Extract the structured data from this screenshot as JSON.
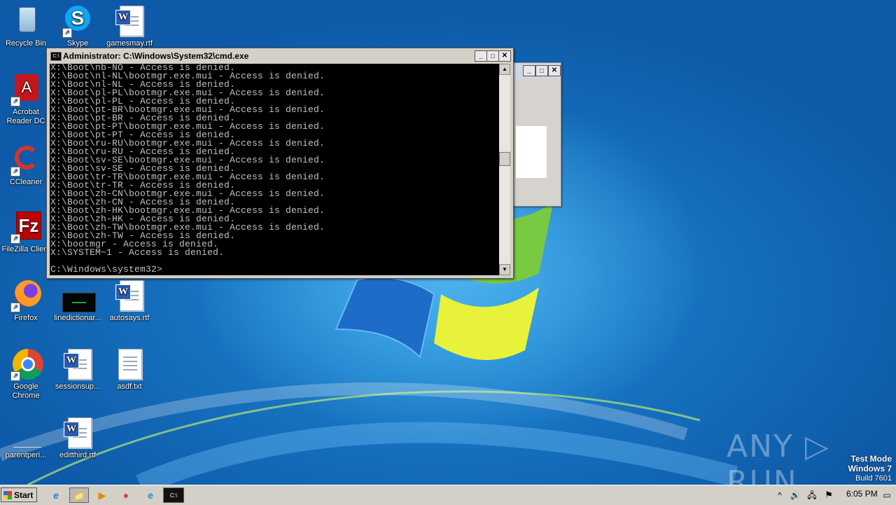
{
  "desktop": {
    "icons": [
      {
        "label": "Recycle Bin",
        "icon": "recycle-bin-icon"
      },
      {
        "label": "Skype",
        "icon": "skype-icon"
      },
      {
        "label": "gamesmay.rtf",
        "icon": "word-document-icon"
      },
      {
        "label": "Acrobat Reader DC",
        "icon": "acrobat-icon"
      },
      {
        "label": "CCleaner",
        "icon": "ccleaner-icon"
      },
      {
        "label": "FileZilla Client",
        "icon": "filezilla-icon"
      },
      {
        "label": "Firefox",
        "icon": "firefox-icon"
      },
      {
        "label": "linedictionar...",
        "icon": "black-file-icon"
      },
      {
        "label": "autosays.rtf",
        "icon": "word-document-icon"
      },
      {
        "label": "Google Chrome",
        "icon": "chrome-icon"
      },
      {
        "label": "sessionsup...",
        "icon": "word-document-icon"
      },
      {
        "label": "asdf.txt",
        "icon": "text-file-icon"
      },
      {
        "label": "parentperi...",
        "icon": "blank-file-icon"
      },
      {
        "label": "editthird.rtf",
        "icon": "word-document-icon"
      }
    ]
  },
  "cmd": {
    "title": "Administrator: C:\\Windows\\System32\\cmd.exe",
    "icon_text": "C:\\",
    "output": "X:\\Boot\\nb-NO - Access is denied.\nX:\\Boot\\nl-NL\\bootmgr.exe.mui - Access is denied.\nX:\\Boot\\nl-NL - Access is denied.\nX:\\Boot\\pl-PL\\bootmgr.exe.mui - Access is denied.\nX:\\Boot\\pl-PL - Access is denied.\nX:\\Boot\\pt-BR\\bootmgr.exe.mui - Access is denied.\nX:\\Boot\\pt-BR - Access is denied.\nX:\\Boot\\pt-PT\\bootmgr.exe.mui - Access is denied.\nX:\\Boot\\pt-PT - Access is denied.\nX:\\Boot\\ru-RU\\bootmgr.exe.mui - Access is denied.\nX:\\Boot\\ru-RU - Access is denied.\nX:\\Boot\\sv-SE\\bootmgr.exe.mui - Access is denied.\nX:\\Boot\\sv-SE - Access is denied.\nX:\\Boot\\tr-TR\\bootmgr.exe.mui - Access is denied.\nX:\\Boot\\tr-TR - Access is denied.\nX:\\Boot\\zh-CN\\bootmgr.exe.mui - Access is denied.\nX:\\Boot\\zh-CN - Access is denied.\nX:\\Boot\\zh-HK\\bootmgr.exe.mui - Access is denied.\nX:\\Boot\\zh-HK - Access is denied.\nX:\\Boot\\zh-TW\\bootmgr.exe.mui - Access is denied.\nX:\\Boot\\zh-TW - Access is denied.\nX:\\bootmgr - Access is denied.\nX:\\SYSTEM~1 - Access is denied.\n\nC:\\Windows\\system32>",
    "buttons": {
      "minimize": "_",
      "maximize": "□",
      "close": "✕"
    },
    "scroll": {
      "up": "▲",
      "down": "▼"
    }
  },
  "watermark": {
    "brand": "ANY ▷ RUN"
  },
  "test_mode": {
    "line1": "Test Mode",
    "line2": "Windows 7",
    "line3": "Build 7601"
  },
  "taskbar": {
    "start_label": "Start",
    "pinned": [
      {
        "name": "internet-explorer-icon",
        "glyph": "e"
      },
      {
        "name": "file-explorer-icon",
        "glyph": "📁"
      },
      {
        "name": "media-player-icon",
        "glyph": "▶"
      },
      {
        "name": "chrome-icon",
        "glyph": "●"
      },
      {
        "name": "edge-icon",
        "glyph": "e"
      },
      {
        "name": "cmd-icon",
        "glyph": "C:\\"
      }
    ],
    "tray": {
      "expand": "^",
      "volume": "🔊",
      "network": "🖧",
      "flag": "⚑",
      "action": "▭"
    },
    "clock": "6:05 PM"
  },
  "colors": {
    "console_bg": "#000000",
    "console_fg": "#c0c0c0",
    "desktop_blue": "#1a78c8"
  }
}
